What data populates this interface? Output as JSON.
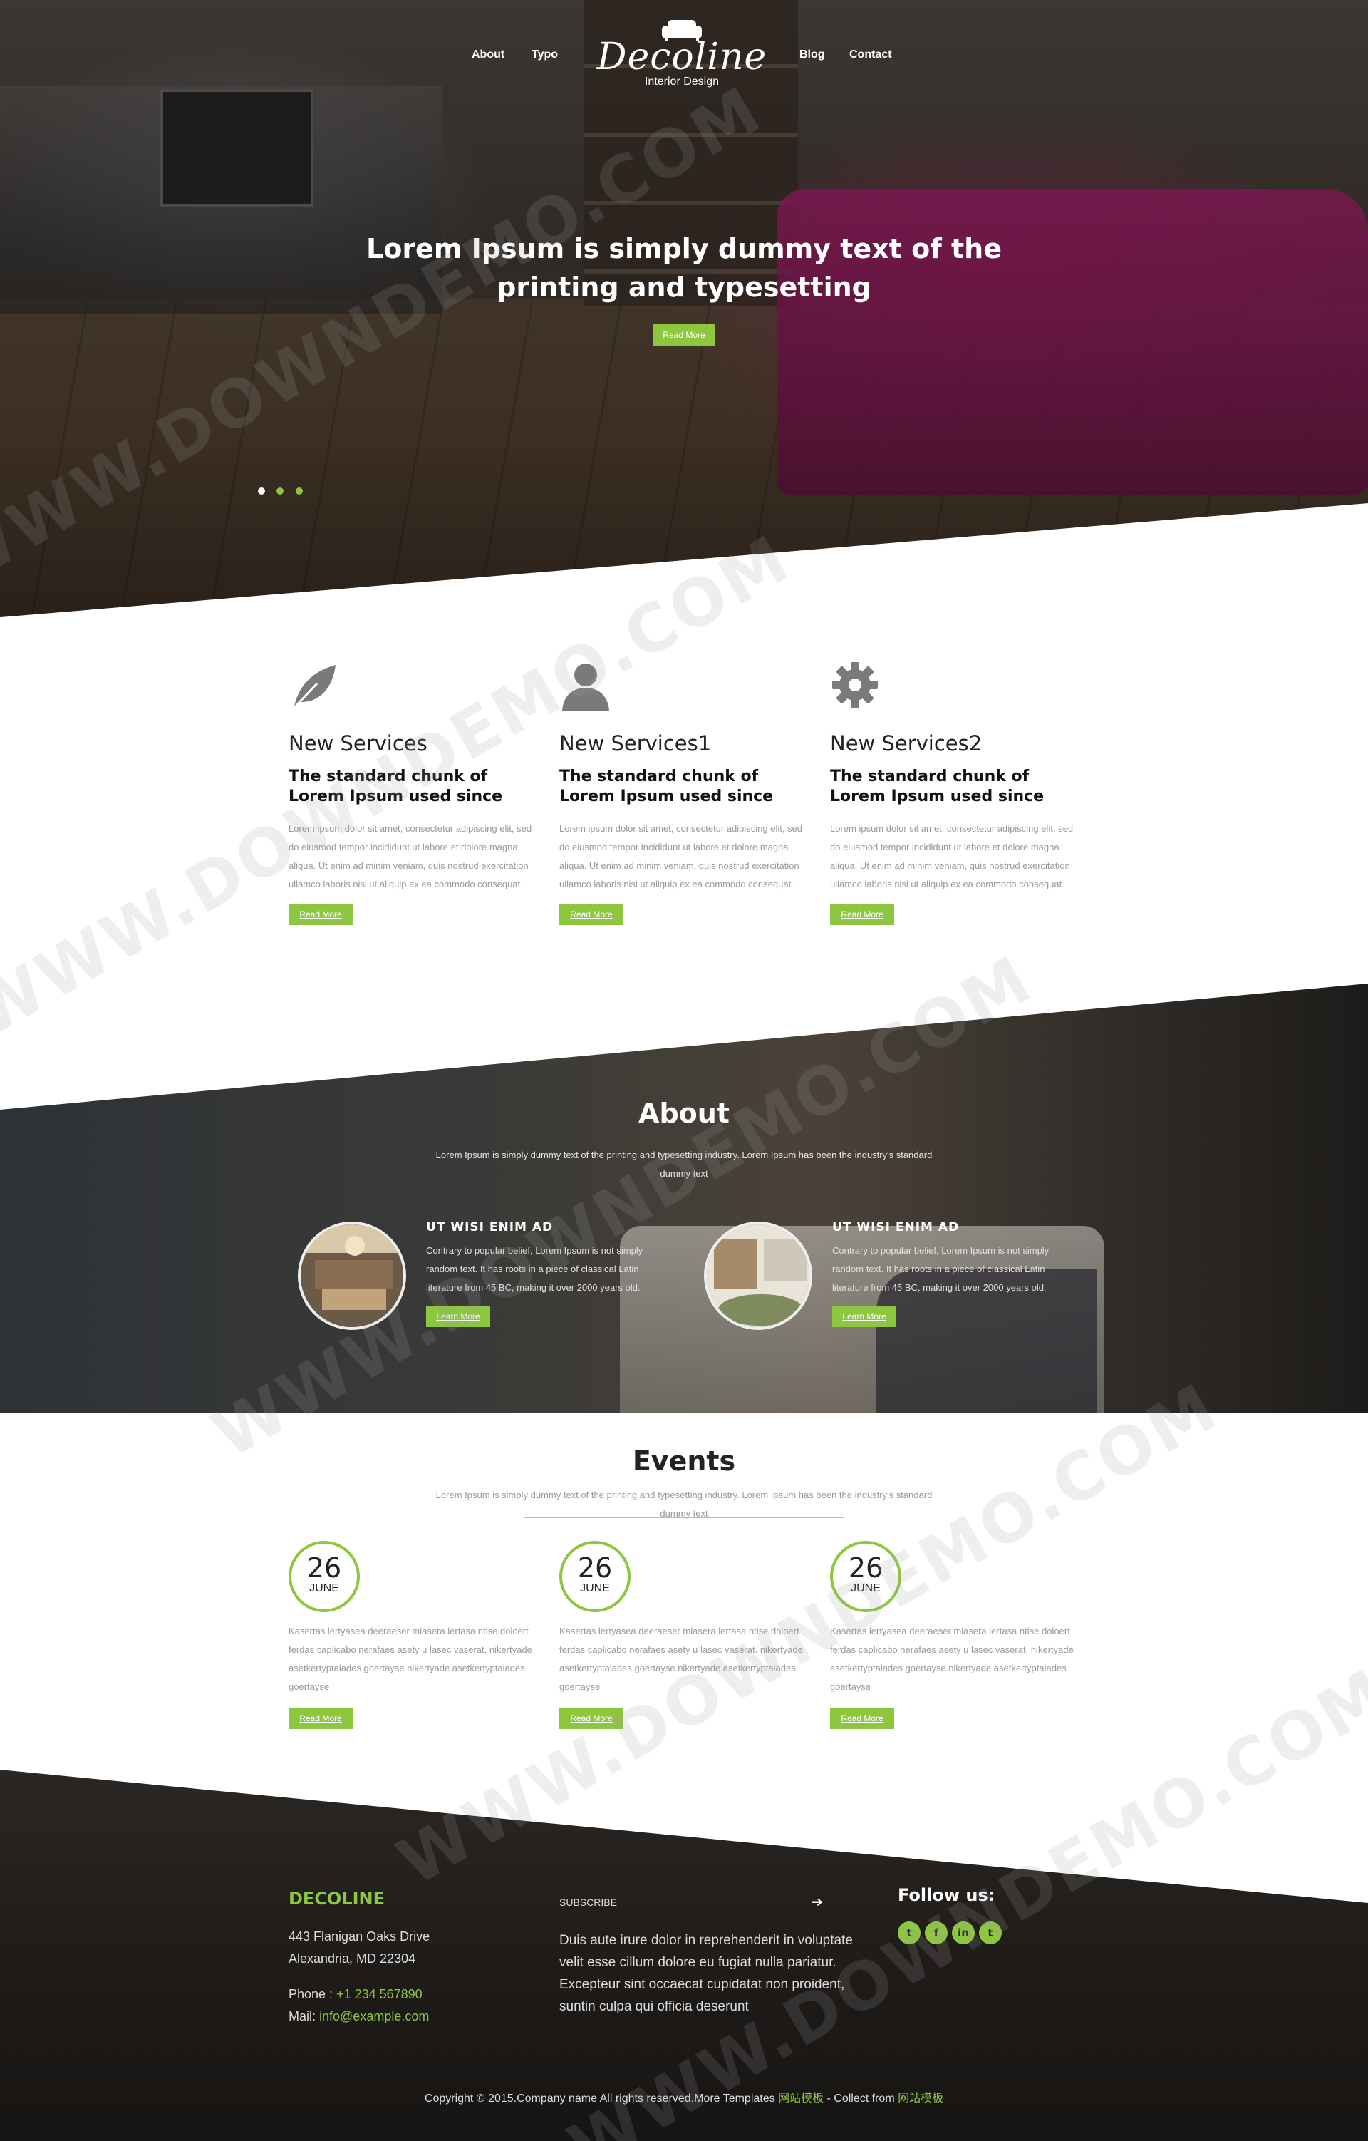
{
  "nav": {
    "left_items": [
      "About",
      "Typo"
    ],
    "right_items": [
      "Blog",
      "Contact"
    ],
    "logo": {
      "brand": "Decoline",
      "tagline": "Interior Design",
      "icon": "sofa-icon"
    }
  },
  "hero": {
    "title": "Lorem Ipsum is simply dummy text of the printing and typesetting",
    "button": "Read More",
    "slides": 3,
    "active_slide": 0
  },
  "services": [
    {
      "icon": "leaf-icon",
      "title": "New Services",
      "subtitle": "The standard chunk of Lorem Ipsum used since",
      "text": "Lorem ipsum dolor sit amet, consectetur adipiscing elit, sed do eiusmod tempor incididunt ut labore et dolore magna aliqua. Ut enim ad minim veniam, quis nostrud exercitation ullamco laboris nisi ut aliquip ex ea commodo consequat.",
      "button": "Read More"
    },
    {
      "icon": "user-icon",
      "title": "New Services1",
      "subtitle": "The standard chunk of Lorem Ipsum used since",
      "text": "Lorem ipsum dolor sit amet, consectetur adipiscing elit, sed do eiusmod tempor incididunt ut labore et dolore magna aliqua. Ut enim ad minim veniam, quis nostrud exercitation ullamco laboris nisi ut aliquip ex ea commodo consequat.",
      "button": "Read More"
    },
    {
      "icon": "gear-icon",
      "title": "New Services2",
      "subtitle": "The standard chunk of Lorem Ipsum used since",
      "text": "Lorem ipsum dolor sit amet, consectetur adipiscing elit, sed do eiusmod tempor incididunt ut labore et dolore magna aliqua. Ut enim ad minim veniam, quis nostrud exercitation ullamco laboris nisi ut aliquip ex ea commodo consequat.",
      "button": "Read More"
    }
  ],
  "about": {
    "title": "About",
    "subtitle": "Lorem Ipsum is simply dummy text of the printing and typesetting industry. Lorem Ipsum has been the industry's standard dummy text",
    "items": [
      {
        "heading": "UT WISI ENIM AD",
        "text": "Contrary to popular belief, Lorem Ipsum is not simply random text. It has roots in a piece of classical Latin literature from 45 BC, making it over 2000 years old.",
        "button": "Learn More"
      },
      {
        "heading": "UT WISI ENIM AD",
        "text": "Contrary to popular belief, Lorem Ipsum is not simply random text. It has roots in a piece of classical Latin literature from 45 BC, making it over 2000 years old.",
        "button": "Learn More"
      }
    ]
  },
  "events": {
    "title": "Events",
    "subtitle": "Lorem Ipsum is simply dummy text of the printing and typesetting industry. Lorem Ipsum has been the industry's standard dummy text",
    "items": [
      {
        "day": "26",
        "month": "JUNE",
        "text": "Kasertas lertyasea deeraeser miasera lertasa ntise doloert ferdas caplicabo nerafaes asety u lasec vaserat. nikertyade asetkertyptaiades goertayse.nikertyade asetkertyptaiades goertayse",
        "button": "Read More"
      },
      {
        "day": "26",
        "month": "JUNE",
        "text": "Kasertas lertyasea deeraeser miasera lertasa ntise doloert ferdas caplicabo nerafaes asety u lasec vaserat. nikertyade asetkertyptaiades goertayse.nikertyade asetkertyptaiades goertayse",
        "button": "Read More"
      },
      {
        "day": "26",
        "month": "JUNE",
        "text": "Kasertas lertyasea deeraeser miasera lertasa ntise doloert ferdas caplicabo nerafaes asety u lasec vaserat. nikertyade asetkertyptaiades goertayse.nikertyade asetkertyptaiades goertayse",
        "button": "Read More"
      }
    ]
  },
  "footer": {
    "brand": "DECOLINE",
    "address_line1": "443 Flanigan Oaks Drive",
    "address_line2": "Alexandria, MD 22304",
    "phone_label": "Phone : ",
    "phone": "+1 234 567890",
    "mail_label": "Mail: ",
    "mail": "info@example.com",
    "subscribe_placeholder": "SUBSCRIBE",
    "text": "Duis aute irure dolor in reprehenderit in voluptate velit esse cillum dolore eu fugiat nulla pariatur. Excepteur sint occaecat cupidatat non proident, suntin culpa qui officia deserunt",
    "follow": "Follow us:",
    "social": [
      {
        "icon": "twitter-icon",
        "glyph": "t"
      },
      {
        "icon": "facebook-icon",
        "glyph": "f"
      },
      {
        "icon": "linkedin-icon",
        "glyph": "in"
      },
      {
        "icon": "twitter-icon",
        "glyph": "t"
      }
    ],
    "copyright_prefix": "Copyright © 2015.Company name All rights reserved.More Templates ",
    "copyright_link1": "网站模板",
    "copyright_mid": " - Collect from ",
    "copyright_link2": "网站模板"
  },
  "watermark": "WWW.DOWNDEMO.COM",
  "colors": {
    "accent": "#8dc63f",
    "dark": "#222222",
    "muted": "#9a9a9a"
  }
}
